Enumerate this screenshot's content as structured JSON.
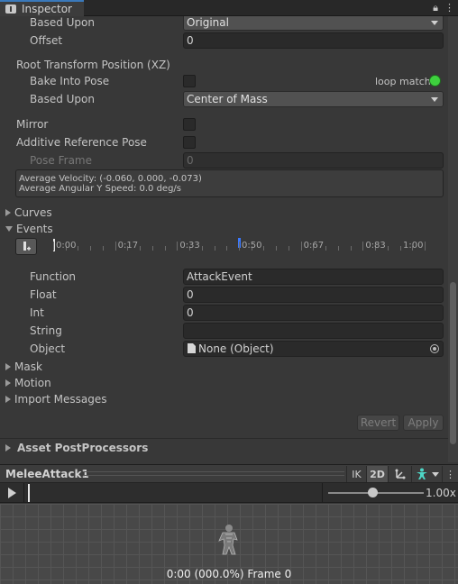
{
  "tab": {
    "title": "Inspector"
  },
  "rows": {
    "based_upon_top": {
      "label": "Based Upon",
      "value": "Original"
    },
    "offset": {
      "label": "Offset",
      "value": "0"
    },
    "root_transform_xz": {
      "heading": "Root Transform Position (XZ)"
    },
    "bake_into_pose": {
      "label": "Bake Into Pose",
      "loop_match": "loop match"
    },
    "based_upon_xz": {
      "label": "Based Upon",
      "value": "Center of Mass"
    },
    "mirror": {
      "label": "Mirror"
    },
    "additive_reference_pose": {
      "label": "Additive Reference Pose"
    },
    "pose_frame": {
      "label": "Pose Frame",
      "value": "0"
    }
  },
  "info": {
    "velocity": "Average Velocity: (-0.060, 0.000, -0.073)",
    "angular": "Average Angular Y Speed: 0.0 deg/s"
  },
  "sections": {
    "curves": "Curves",
    "events": "Events",
    "mask": "Mask",
    "motion": "Motion",
    "import_messages": "Import Messages",
    "asset_postprocessors": "Asset PostProcessors"
  },
  "timeline": {
    "labels": [
      "0:00",
      "0:17",
      "0:33",
      "0:50",
      "0:67",
      "0:83",
      "1:00"
    ],
    "marker_fraction": 0.5
  },
  "event": {
    "function": {
      "label": "Function",
      "value": "AttackEvent"
    },
    "float": {
      "label": "Float",
      "value": "0"
    },
    "int": {
      "label": "Int",
      "value": "0"
    },
    "string": {
      "label": "String",
      "value": ""
    },
    "object": {
      "label": "Object",
      "value": "None (Object)"
    }
  },
  "buttons": {
    "revert": "Revert",
    "apply": "Apply"
  },
  "preview": {
    "title": "MeleeAttack1",
    "ik": "IK",
    "mode_2d": "2D",
    "speed": "1.00x",
    "speed_fraction": 0.46,
    "frame_status": "0:00 (000.0%) Frame 0"
  },
  "colors": {
    "loop_match_indicator": "#3ed13e",
    "timeline_marker": "#3a79ff",
    "accent": "#3a79bb"
  }
}
